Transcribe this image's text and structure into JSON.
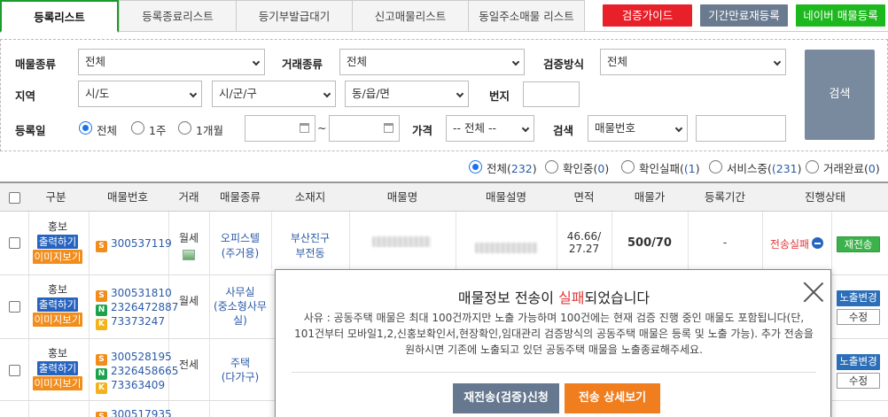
{
  "tabs": [
    "등록리스트",
    "등록종료리스트",
    "등기부발급대기",
    "신고매물리스트",
    "동일주소매물 리스트"
  ],
  "top_buttons": {
    "guide": "검증가이드",
    "reregister": "기간만료재등록",
    "naver": "네이버 매물등록"
  },
  "filter": {
    "property_type_label": "매물종류",
    "property_type_value": "전체",
    "deal_type_label": "거래종류",
    "deal_type_value": "전체",
    "verify_label": "검증방식",
    "verify_value": "전체",
    "region_label": "지역",
    "sido": "시/도",
    "sigungu": "시/군/구",
    "dong": "동/읍/면",
    "bunji_label": "번지",
    "regdate_label": "등록일",
    "period_all": "전체",
    "period_1w": "1주",
    "period_1m": "1개월",
    "tilde": "~",
    "price_label": "가격",
    "price_value": "-- 전체 --",
    "search_label": "검색",
    "search_type": "매물번호",
    "search_button": "검색"
  },
  "status_filters": {
    "all_label": "전체(",
    "all_count": "232",
    "all_close": ")",
    "checking_label": "확인중(",
    "checking_count": "0",
    "checking_close": ")",
    "failed_label": "확인실패(",
    "failed_count": "(1",
    "failed_close": ")",
    "service_label": "서비스중(",
    "service_count": "(231",
    "service_close": ")",
    "done_label": "거래완료(",
    "done_count": "0",
    "done_close": ")"
  },
  "table": {
    "headers": [
      "구분",
      "매물번호",
      "거래",
      "매물종류",
      "소재지",
      "매물명",
      "매물설명",
      "면적",
      "매물가",
      "등록기간",
      "진행상태"
    ],
    "rows": [
      {
        "gubun": "홍보",
        "print": "출력하기",
        "image": "이미지보기",
        "ids": [
          {
            "badge": "S",
            "id": "300537119"
          }
        ],
        "deal": "월세",
        "ptype": "오피스텔",
        "ptype_sub": "(주거용)",
        "loc1": "부산진구",
        "loc2": "부전동",
        "area1": "46.66/",
        "area2": "27.27",
        "price": "500/70",
        "period": "-",
        "status": "전송실패",
        "action": "재전송"
      },
      {
        "gubun": "홍보",
        "print": "출력하기",
        "image": "이미지보기",
        "ids": [
          {
            "badge": "S",
            "id": "300531810"
          },
          {
            "badge": "N",
            "id": "2326472887"
          },
          {
            "badge": "K",
            "id": "73373247"
          }
        ],
        "deal": "월세",
        "ptype": "사무실",
        "ptype_sub": "(중소형사무",
        "ptype_sub2": "실)",
        "action1": "노출변경",
        "action2": "수정"
      },
      {
        "gubun": "홍보",
        "print": "출력하기",
        "image": "이미지보기",
        "ids": [
          {
            "badge": "S",
            "id": "300528195"
          },
          {
            "badge": "N",
            "id": "2326458665"
          },
          {
            "badge": "K",
            "id": "73363409"
          }
        ],
        "deal": "전세",
        "ptype": "주택",
        "ptype_sub": "(다가구)",
        "action1": "노출변경",
        "action2": "수정"
      },
      {
        "ids": [
          {
            "badge": "S",
            "id": "300517935"
          }
        ]
      }
    ]
  },
  "modal": {
    "title_pre": "매물정보 전송이 ",
    "title_fail": "실패",
    "title_post": "되었습니다",
    "body": "사유 : 공동주택 매물은 최대 100건까지만 노출 가능하며 100건에는 현재 검증 진행 중인 매물도 포함됩니다(단, 101건부터 모바일1,2,신홍보확인서,현장확인,임대관리 검증방식의 공동주택 매물은 등록 및 노출 가능). 추가 전송을 원하시면 기존에 노출되고 있던 공동주택 매물을 노출종료해주세요.",
    "resend_button": "재전송(검증)신청",
    "detail_button": "전송 상세보기"
  },
  "colors": {
    "active_tab": "#1a9c2c",
    "guide": "#e8202a",
    "reregister": "#6b7b8f",
    "naver": "#1db81d",
    "search_button": "#7a8a9e",
    "badge_S": "#f28c1b",
    "badge_N": "#1aa34a",
    "badge_K": "#f2b21b",
    "fail": "#e03a3a"
  }
}
